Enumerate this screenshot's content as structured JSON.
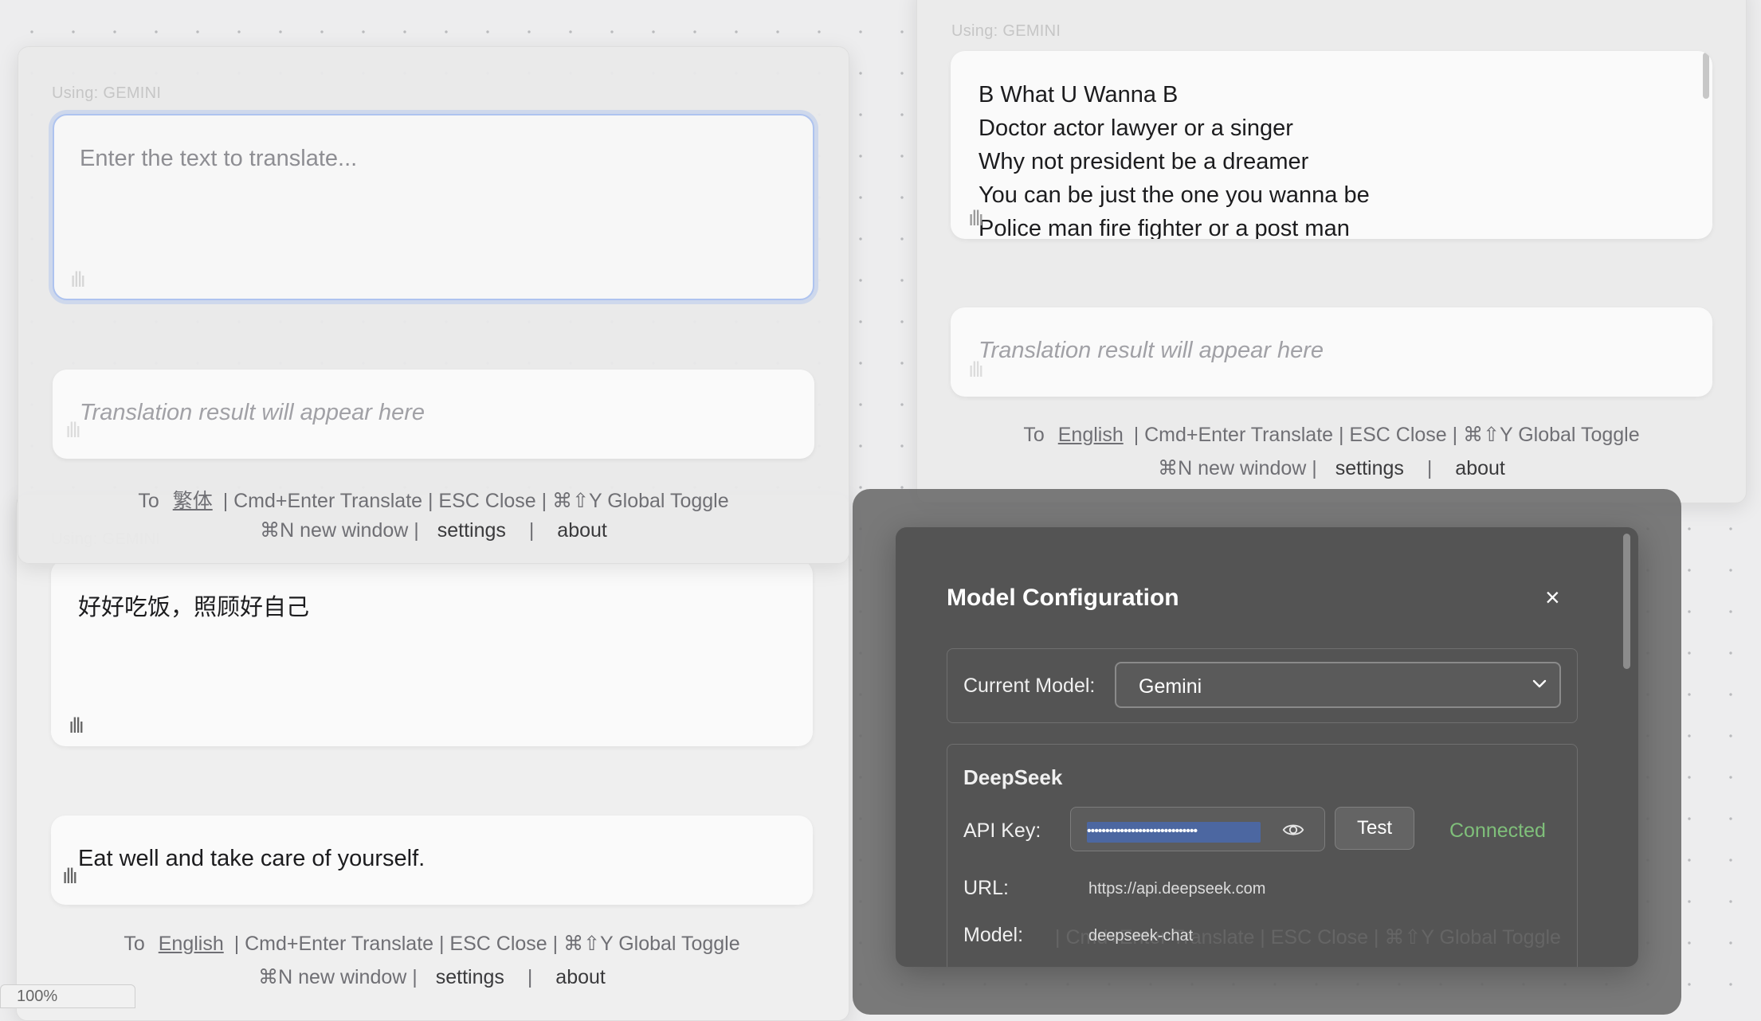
{
  "using_label": "Using: GEMINI",
  "input_placeholder": "Enter the text to translate...",
  "result_placeholder": "Translation result will appear here",
  "footer": {
    "to": "To",
    "shortcuts": "| Cmd+Enter Translate | ESC Close | ⌘⇧Y Global Toggle",
    "new_window": "⌘N new window |",
    "settings": "settings",
    "separator": "|",
    "about": "about"
  },
  "window_left_top": {
    "target_language": "繁体"
  },
  "window_right_top": {
    "target_language": "English",
    "lyrics": [
      "B What U Wanna B",
      "Doctor actor lawyer or a singer",
      "Why not president be a dreamer",
      "You can be just the one you wanna be",
      "Police man fire fighter or a post man"
    ]
  },
  "window_left_bottom": {
    "target_language": "English",
    "input_text": "好好吃饭，照顾好自己",
    "result_text": "Eat well and take care of yourself."
  },
  "model_config": {
    "title": "Model Configuration",
    "close_icon": "×",
    "current_model_label": "Current Model:",
    "current_model_value": "Gemini",
    "provider_name": "DeepSeek",
    "api_key_label": "API Key:",
    "api_key_masked": "••••••••••••••••••••••••••••••",
    "test_label": "Test",
    "status": "Connected",
    "status_color": "#7fbf7a",
    "url_label": "URL:",
    "url_value": "https://api.deepseek.com",
    "model_label": "Model:",
    "model_value": "deepseek-chat"
  },
  "zoom_level": "100%"
}
